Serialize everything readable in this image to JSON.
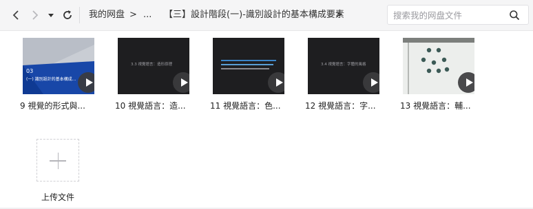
{
  "toolbar": {
    "breadcrumb": [
      "我的网盘",
      ">",
      "...",
      "【三】設計階段(一)-識別設計的基本構成要素",
      ">"
    ],
    "search_placeholder": "搜索我的网盘文件"
  },
  "files": [
    {
      "label": "9 視覺的形式與...",
      "thumb_number": "03",
      "thumb_caption": "(一) 識別設計的基本構成..."
    },
    {
      "label": "10 視覺語言：造...",
      "thumb_caption": "3.3 視覺語言：造形原理"
    },
    {
      "label": "11 視覺語言：色...",
      "thumb_caption": "色彩的基本屬性與視覺感受"
    },
    {
      "label": "12 視覺語言：字...",
      "thumb_caption": "3.4 視覺語言：字體的風格"
    },
    {
      "label": "13 視覺語言：輔..."
    }
  ],
  "upload": {
    "label": "上传文件"
  },
  "colors": {
    "toolbar_bg": "#f5f5f6",
    "thumb_bg": "#1e1e20",
    "accent_blue": "#1847a8"
  }
}
